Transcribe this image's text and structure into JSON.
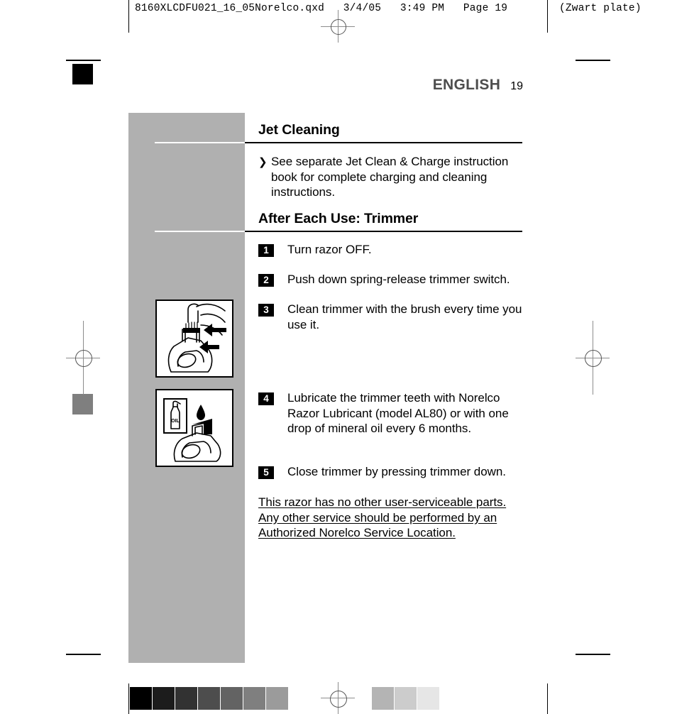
{
  "slug": {
    "filename": "8160XLCDFU021_16_05Norelco.qxd",
    "date": "3/4/05",
    "time": "3:49 PM",
    "page_label": "Page 19",
    "plate": "(Zwart plate)"
  },
  "header": {
    "language": "ENGLISH",
    "page_number": "19"
  },
  "sections": [
    {
      "title": "Jet Cleaning",
      "bullet_glyph": "❯",
      "bullet_text": "See separate Jet Clean & Charge instruction book for complete charging and cleaning instructions."
    },
    {
      "title": "After Each Use: Trimmer"
    }
  ],
  "steps": [
    {
      "number": "1",
      "text": "Turn razor OFF."
    },
    {
      "number": "2",
      "text": "Push down spring-release trimmer switch."
    },
    {
      "number": "3",
      "text": "Clean trimmer with the brush every time you use it."
    },
    {
      "number": "4",
      "text": "Lubricate the trimmer teeth with Norelco Razor Lubricant (model AL80) or with one drop of mineral oil every 6 months."
    },
    {
      "number": "5",
      "text": "Close trimmer by pressing trimmer down."
    }
  ],
  "footnote": {
    "text": "This razor has no other user-serviceable parts. Any other service should be performed by an Authorized Norelco Service Location."
  },
  "illustrations": [
    {
      "name": "brush-cleaning-trimmer",
      "caption_ref": "3",
      "oil_label": ""
    },
    {
      "name": "oil-lubricating-trimmer",
      "caption_ref": "4",
      "oil_label": "OIL"
    }
  ],
  "colorbar": {
    "dark_swatches": [
      "#000000",
      "#1c1c1c",
      "#323232",
      "#4d4d4d",
      "#636363",
      "#7f7f7f",
      "#9b9b9b"
    ],
    "light_swatches": [
      "#b4b4b4",
      "#cccccc",
      "#e6e6e6"
    ]
  },
  "marks": {
    "black_square_color": "#000000",
    "gray_square_color": "#7f7f7f",
    "panel_color": "#b0b0b0"
  }
}
